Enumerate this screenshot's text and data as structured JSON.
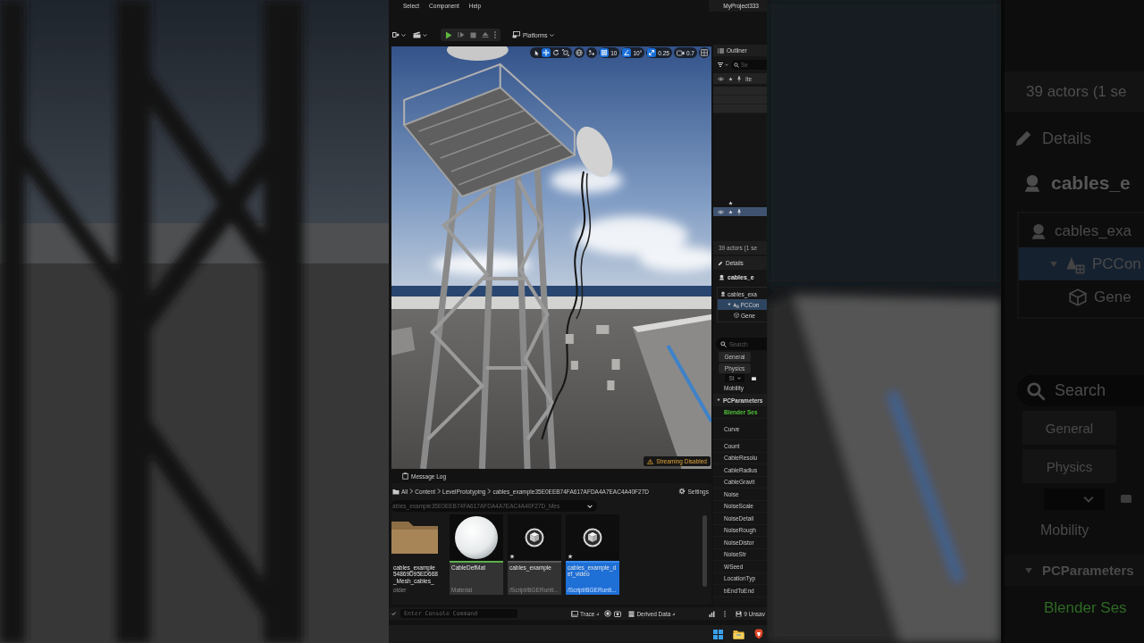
{
  "menu_bar": {
    "items": [
      "Select",
      "Component",
      "Help"
    ],
    "project": "MyProject333"
  },
  "toolbar": {
    "platforms": "Platforms"
  },
  "viewport": {
    "transform_tools": [
      {
        "kind": "select",
        "selected": false
      },
      {
        "kind": "translate",
        "selected": true
      },
      {
        "kind": "rotate",
        "selected": false
      },
      {
        "kind": "scale",
        "selected": false
      }
    ],
    "snaps": [
      {
        "kind": "grid",
        "value": "10",
        "on": true
      },
      {
        "kind": "angle",
        "value": "10°",
        "on": true
      },
      {
        "kind": "scale",
        "value": "0.25",
        "on": true
      }
    ],
    "camera_speed": "0.7",
    "notice": "Streaming Disabled"
  },
  "outliner": {
    "title": "Outliner",
    "search_placeholder": "Se",
    "column_4": "Ite",
    "rows": [
      {
        "kind": "blank",
        "selected": false
      },
      {
        "kind": "blank",
        "selected": false
      },
      {
        "kind": "blank",
        "selected": false
      },
      {
        "kind": "starred",
        "selected": false
      },
      {
        "kind": "actor",
        "selected": true
      }
    ],
    "status": "39 actors (1 se"
  },
  "details": {
    "title": "Details",
    "actor": "cables_e",
    "components": [
      {
        "label": "cables_exa",
        "kind": "actor",
        "selected": false,
        "children": [
          {
            "label": "PCCon",
            "kind": "pcg",
            "expanded": true,
            "selected": true,
            "children": [
              {
                "label": "Gene",
                "kind": "generator",
                "selected": false
              }
            ]
          }
        ]
      }
    ],
    "search_placeholder": "Search",
    "filters": [
      "General",
      "Physics"
    ],
    "dropdown": "St",
    "mobility": "Mobility",
    "section": {
      "title": "PCParameters",
      "expanded": true
    },
    "properties": [
      {
        "name": "Blender Ses",
        "kind": "link"
      },
      {
        "name": "Curve",
        "kind": "tall"
      },
      {
        "name": "Count",
        "kind": "row"
      },
      {
        "name": "CableResolu",
        "kind": "row"
      },
      {
        "name": "CableRadius",
        "kind": "row"
      },
      {
        "name": "CableGravit",
        "kind": "row"
      },
      {
        "name": "Noise",
        "kind": "row"
      },
      {
        "name": "NoiseScale",
        "kind": "row"
      },
      {
        "name": "NoiseDetail",
        "kind": "row"
      },
      {
        "name": "NoiseRough",
        "kind": "row"
      },
      {
        "name": "NoiseDistor",
        "kind": "row"
      },
      {
        "name": "NoiseStr",
        "kind": "row"
      },
      {
        "name": "WSeed",
        "kind": "row"
      },
      {
        "name": "LocationTyp",
        "kind": "row"
      },
      {
        "name": "bEndToEnd",
        "kind": "row"
      }
    ]
  },
  "message_log": "Message Log",
  "content_browser": {
    "breadcrumb": [
      "All",
      "Content",
      "LevelPrototyping",
      "cables_example35E0EEB74FA617AFDA4A7EAC4A40F27D"
    ],
    "settings": "Settings",
    "path": "ables_example35E0EEB74FA617AFDA4A7EAC4A40F27D_Mes",
    "assets": [
      {
        "kind": "folder",
        "name": "cables_example\n54869D95ED668\n_Mesh_cables_",
        "type": "older",
        "selected": false
      },
      {
        "kind": "material",
        "name": "CableDefMat",
        "type": "Material",
        "selected": false
      },
      {
        "kind": "blueprint",
        "name": "cables_example",
        "type": "/Script/BGERunti...",
        "selected": false
      },
      {
        "kind": "blueprint",
        "name": "cables_example_def_video",
        "type": "/Script/BGERunti...",
        "selected": true
      }
    ]
  },
  "status_bar": {
    "console_placeholder": "Enter Console Command",
    "trace": "Trace",
    "derived_data": "Derived Data",
    "unsaved": "9 Unsav"
  },
  "backdrop_panel": {
    "status": "39 actors (1 se",
    "title": "Details",
    "actor": "cables_e",
    "components": [
      {
        "label": "cables_exa",
        "kind": "actor",
        "selected": false,
        "children": [
          {
            "label": "PCCon",
            "kind": "pcg",
            "expanded": true,
            "selected": true,
            "children": [
              {
                "label": "Gene",
                "kind": "generator",
                "selected": false
              }
            ]
          }
        ]
      }
    ],
    "search_placeholder": "Search",
    "filters": [
      "General",
      "Physics"
    ],
    "mobility": "Mobility",
    "section": {
      "title": "PCParameters",
      "expanded": true
    },
    "property": "Blender Ses"
  }
}
